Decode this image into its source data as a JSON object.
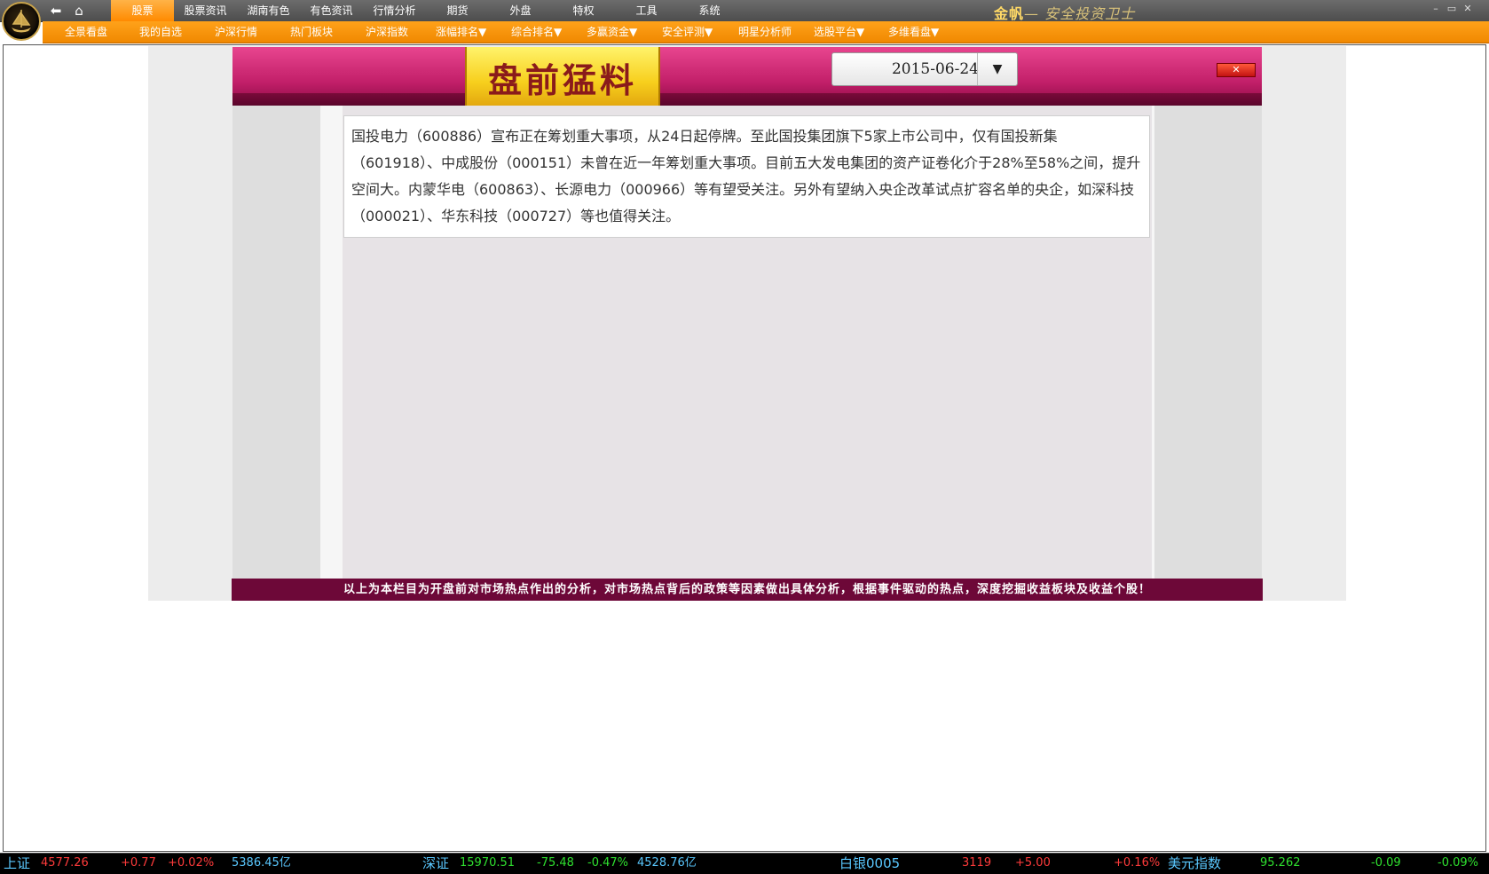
{
  "menu": {
    "items": [
      "股票",
      "股票资讯",
      "湖南有色",
      "有色资讯",
      "行情分析",
      "期货",
      "外盘",
      "特权",
      "工具",
      "系统"
    ],
    "active_index": 0
  },
  "brand": {
    "name": "金帆",
    "slogan": "— 安全投资卫士"
  },
  "window_controls": {
    "minimize": "–",
    "restore": "▭",
    "close": "✕"
  },
  "submenu": {
    "items": [
      "全景看盘",
      "我的自选",
      "沪深行情",
      "热门板块",
      "沪深指数",
      "涨幅排名▼",
      "综合排名▼",
      "多赢资金▼",
      "安全评测▼",
      "明星分析师",
      "选股平台▼",
      "多维看盘▼"
    ]
  },
  "panel": {
    "title": "盘前猛料",
    "date": "2015-06-24",
    "close_label": "✕",
    "article": "国投电力（600886）宣布正在筹划重大事项，从24日起停牌。至此国投集团旗下5家上市公司中，仅有国投新集（601918）、中成股份（000151）未曾在近一年筹划重大事项。目前五大发电集团的资产证卷化介于28%至58%之间，提升空间大。内蒙华电（600863）、长源电力（000966）等有望受关注。另外有望纳入央企改革试点扩容名单的央企，如深科技（000021）、华东科技（000727）等也值得关注。",
    "footer": "以上为本栏目为开盘前对市场热点作出的分析，对市场热点背后的政策等因素做出具体分析，根据事件驱动的热点，深度挖掘收益板块及收益个股！"
  },
  "ticker": {
    "sh": {
      "name": "上证",
      "value": "4577.26",
      "change": "+0.77",
      "pct": "+0.02%",
      "volume": "5386.45亿"
    },
    "sz": {
      "name": "深证",
      "value": "15970.51",
      "change": "-75.48",
      "pct": "-0.47%",
      "volume": "4528.76亿"
    },
    "silver": {
      "name": "白银0005",
      "value": "3119",
      "change": "+5.00",
      "pct": "+0.16%"
    },
    "usd": {
      "name": "美元指数",
      "value": "95.262",
      "change": "-0.09",
      "pct": "-0.09%"
    }
  }
}
